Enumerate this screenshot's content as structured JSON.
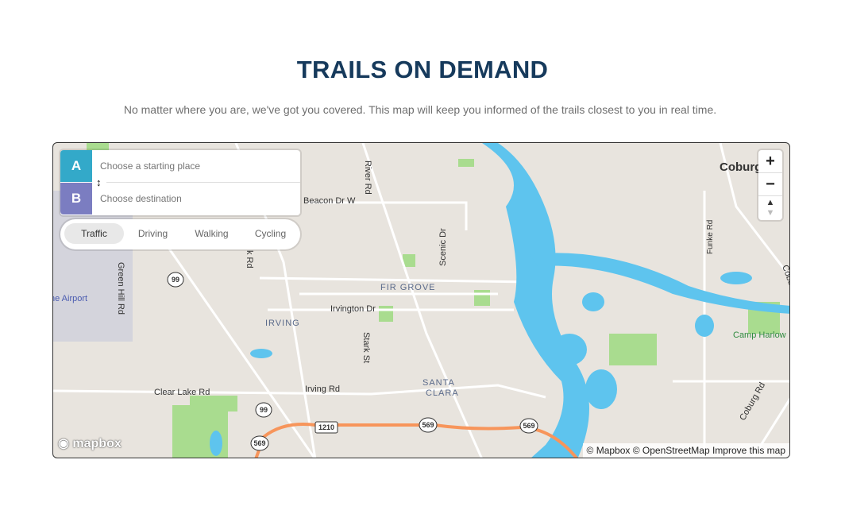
{
  "header": {
    "title": "TRAILS ON DEMAND",
    "subtitle": "No matter where you are, we've got you covered. This map will keep you informed of the trails closest to you in real time."
  },
  "directions": {
    "origin": {
      "label": "A",
      "placeholder": "Choose a starting place",
      "color": "#33a9c9"
    },
    "destination": {
      "label": "B",
      "placeholder": "Choose destination",
      "color": "#7b7dc1"
    },
    "swap_icon": "swap-vertical-icon"
  },
  "modes": [
    {
      "label": "Traffic",
      "active": true
    },
    {
      "label": "Driving"
    },
    {
      "label": "Walking"
    },
    {
      "label": "Cycling"
    }
  ],
  "zoom_controls": {
    "zoom_in": "+",
    "zoom_out": "−",
    "compass": "compass-icon"
  },
  "map_labels": {
    "coburg": "Coburg",
    "river_rd": "River Rd",
    "beacon": "Beacon Dr W",
    "scenic": "Scenic Dr",
    "green_hill": "Green Hill Rd",
    "airport": "he Airport",
    "fir_grove": "FIR GROVE",
    "irvington": "Irvington Dr",
    "irving": "IRVING",
    "stark": "Stark St",
    "santa": "SANTA",
    "clara": "CLARA",
    "clear_lake": "Clear Lake Rd",
    "irving_rd": "Irving Rd",
    "camp_harlow": "Camp Harlow",
    "funke": "Funke Rd",
    "coburg_rd": "Coburg Rd",
    "k_rd": "k Rd",
    "coburg_rd2": "Cobu"
  },
  "shields": [
    "99",
    "99",
    "569",
    "1210",
    "569",
    "569"
  ],
  "attribution": "© Mapbox © OpenStreetMap Improve this map",
  "logo": "mapbox",
  "colors": {
    "water": "#5ec4ee",
    "park": "#a9dc8f",
    "highway": "#f7955b",
    "land": "#e8e4de"
  }
}
